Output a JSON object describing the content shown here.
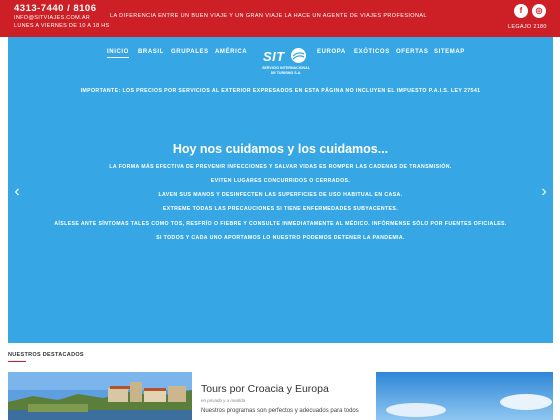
{
  "topbar": {
    "phone": "4313-7440 / 8106",
    "email": "INFO@SITVIAJES.COM.AR",
    "hours": "LUNES A VIERNES DE 10 A 18 HS",
    "tagline": "LA DIFERENCIA ENTRE UN BUEN VIAJE Y UN GRAN VIAJE LA HACE UN AGENTE DE VIAJES PROFESIONAL",
    "social": [
      {
        "icon": "facebook-icon",
        "glyph": "f"
      },
      {
        "icon": "instagram-icon",
        "glyph": "◎"
      }
    ],
    "legajo": "LEGAJO 2180"
  },
  "nav": {
    "left": [
      "INICIO",
      "BRASIL",
      "GRUPALES",
      "AMÉRICA"
    ],
    "right": [
      "EUROPA",
      "EXÓTICOS",
      "OFERTAS",
      "SITEMAP"
    ],
    "active": "INICIO"
  },
  "logo": {
    "name": "SIT",
    "line1": "SERVICIO INTERNACIONAL",
    "line2": "DE TURISMO S.A."
  },
  "notice": "IMPORTANTE: LOS PRECIOS POR SERVICIOS AL EXTERIOR EXPRESADOS EN ESTA PÁGINA NO INCLUYEN EL IMPUESTO P.A.I.S. LEY 27541",
  "slide": {
    "headline": "Hoy nos cuidamos y los cuidamos...",
    "lines": [
      "LA FORMA MÁS EFECTIVA DE PREVENIR INFECCIONES Y SALVAR VIDAS ES ROMPER LAS CADENAS DE TRANSMISIÓN.",
      "EVITEN LUGARES CONCURRIDOS O CERRADOS.",
      "LAVEN SUS MANOS Y DESINFECTEN LAS SUPERFICIES DE USO HABITUAL EN CASA.",
      "EXTREME TODAS LAS PRECAUCIONES SI TIENE ENFERMEDADES SUBYACENTES.",
      "AÍSLESE ANTE SÍNTOMAS TALES COMO TOS, RESFRÍO O FIEBRE Y CONSULTE INMEDIATAMENTE AL MÉDICO. INFÓRMENSE SÓLO POR FUENTES OFICIALES.",
      "SI TODOS Y CADA UNO APORTAMOS LO NUESTRO PODEMOS DETENER LA PANDEMIA."
    ],
    "prev": "‹",
    "next": "›"
  },
  "featured": {
    "heading": "NUESTROS DESTACADOS",
    "card": {
      "title": "Tours por Croacia y Europa",
      "subtitle": "en privado y a medida",
      "description": "Nuestros programas son perfectos y adecuados para todos"
    }
  },
  "colors": {
    "brand_red": "#cc2026",
    "hero_blue": "#36a7e4"
  }
}
